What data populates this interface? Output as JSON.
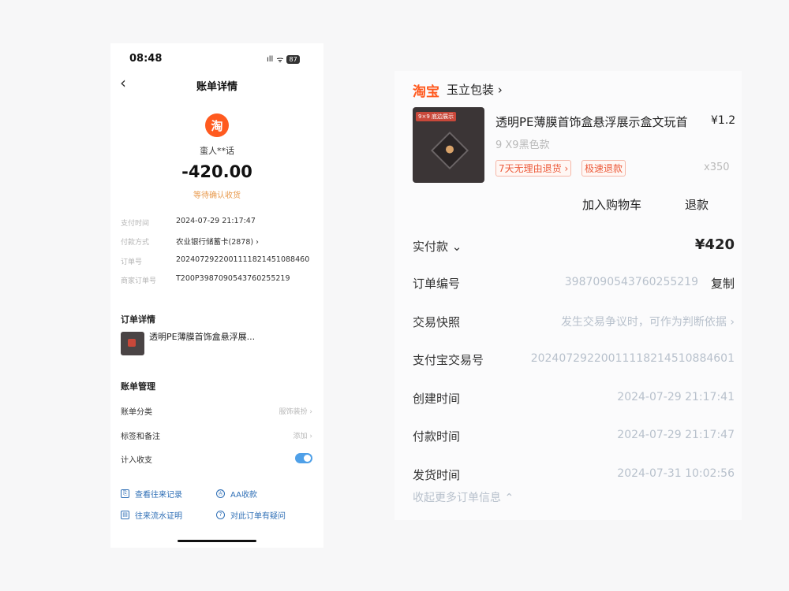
{
  "status_bar": {
    "time": "08:48",
    "signal": "ıll",
    "wifi": "ᯤ",
    "battery": "87"
  },
  "left": {
    "nav_title": "账单详情",
    "back_glyph": "‹",
    "logo_char": "淘",
    "merchant": "蛮人**话",
    "amount": "-420.00",
    "amount_status": "等待确认收货",
    "details": [
      {
        "label": "支付时间",
        "value": "2024-07-29 21:17:47"
      },
      {
        "label": "付款方式",
        "value": "农业银行储蓄卡(2878) ›"
      },
      {
        "label": "订单号",
        "value": "2024072922001111821451088460"
      },
      {
        "label": "商家订单号",
        "value": "T200P3987090543760255219"
      }
    ],
    "order_section_title": "订单详情",
    "order_item_name": "透明PE薄膜首饰盒悬浮展...",
    "bill_mgmt_title": "账单管理",
    "bill_rows": [
      {
        "label": "账单分类",
        "value": "服饰装扮 ›"
      },
      {
        "label": "标签和备注",
        "value": "添加 ›"
      },
      {
        "label": "计入收支",
        "value": ""
      }
    ],
    "links": [
      {
        "icon": "⎘",
        "label": "查看往来记录"
      },
      {
        "icon": "Ⓐ",
        "label": "AA收款"
      },
      {
        "icon": "▤",
        "label": "往来流水证明"
      },
      {
        "icon": "?",
        "label": "对此订单有疑问"
      }
    ]
  },
  "right": {
    "shop_logo": "淘宝",
    "shop_name": "玉立包装 ›",
    "thumb_tag": "9×9 底边展示",
    "product_title": "透明PE薄膜首饰盒悬浮展示盒文玩首",
    "product_price": "¥1.2",
    "product_spec": "9 X9黑色款",
    "badges": [
      "7天无理由退货 ›",
      "极速退款"
    ],
    "quantity": "x350",
    "buttons": {
      "add_cart": "加入购物车",
      "refund": "退款"
    },
    "paid_label": "实付款 ⌄",
    "paid_amount": "¥420",
    "order_no_label": "订单编号",
    "order_no_value": "3987090543760255219",
    "copy_label": "复制",
    "snapshot_label": "交易快照",
    "snapshot_value": "发生交易争议时，可作为判断依据 ›",
    "alipay_label": "支付宝交易号",
    "alipay_value": "20240729220011118214510884601",
    "create_label": "创建时间",
    "create_value": "2024-07-29 21:17:41",
    "pay_label": "付款时间",
    "pay_value": "2024-07-29 21:17:47",
    "ship_label": "发货时间",
    "ship_value": "2024-07-31 10:02:56",
    "collapse_label": "收起更多订单信息 ⌃"
  },
  "colors": {
    "taobao_orange": "#ff5a1f",
    "link_blue": "#2f6fb6",
    "toggle_blue": "#4fa0e8",
    "pending_orange": "#e89a4d"
  }
}
